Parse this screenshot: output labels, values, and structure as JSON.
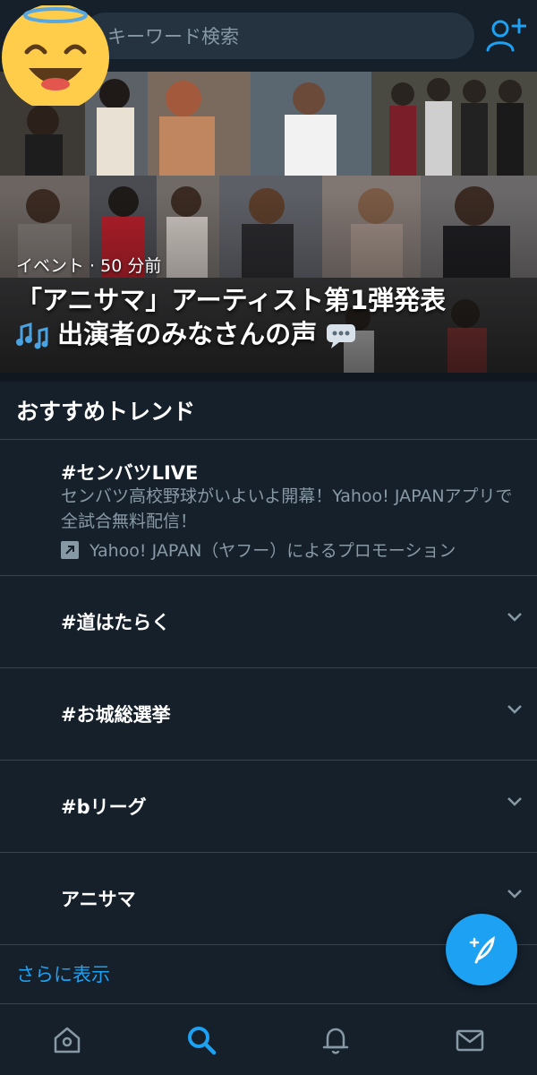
{
  "search": {
    "placeholder": "キーワード検索"
  },
  "hero": {
    "meta": "イベント · 50 分前",
    "title_line1": "「アニサマ」アーティスト第1弾発表",
    "title_line2": "出演者のみなさんの声"
  },
  "trends": {
    "heading": "おすすめトレンド",
    "promoted": {
      "tag": "#センバツLIVE",
      "description": "センバツ高校野球がいよいよ開幕！Yahoo! JAPANアプリで全試合無料配信！",
      "promoter": "Yahoo! JAPAN（ヤフー）によるプロモーション"
    },
    "items": [
      {
        "label": "#道はたらく"
      },
      {
        "label": "#お城総選挙"
      },
      {
        "label": "#bリーグ"
      },
      {
        "label": "アニサマ"
      }
    ],
    "show_more": "さらに表示"
  },
  "nav": {
    "items": [
      "home-icon",
      "search-icon",
      "notifications-icon",
      "messages-icon"
    ],
    "active": "search-icon"
  },
  "colors": {
    "background": "#15202b",
    "accent": "#1da1f2",
    "secondary_text": "#8899a6",
    "divider": "#38444d"
  }
}
